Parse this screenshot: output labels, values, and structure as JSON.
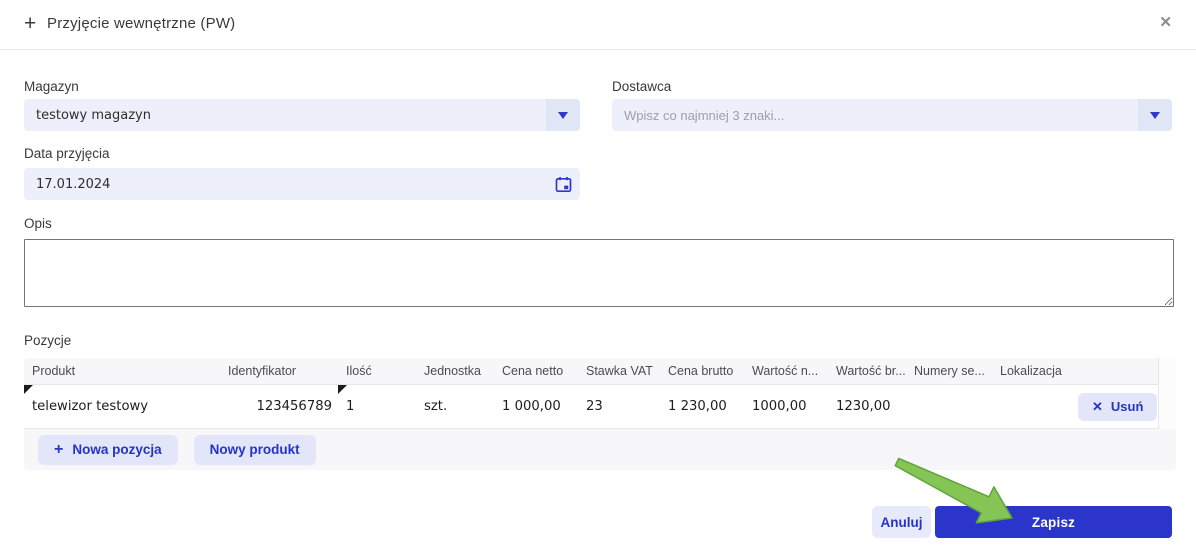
{
  "dialog": {
    "title": "Przyjęcie wewnętrzne (PW)",
    "plus_icon": "+",
    "close_icon": "✕"
  },
  "form": {
    "magazyn": {
      "label": "Magazyn",
      "value": "testowy magazyn"
    },
    "dostawca": {
      "label": "Dostawca",
      "placeholder": "Wpisz co najmniej 3 znaki..."
    },
    "data_przyjecia": {
      "label": "Data przyjęcia",
      "value": "17.01.2024"
    },
    "opis": {
      "label": "Opis",
      "value": ""
    }
  },
  "pozycje": {
    "label": "Pozycje",
    "columns": [
      "Produkt",
      "Identyfikator",
      "Ilość",
      "Jednostka",
      "Cena netto",
      "Stawka VAT",
      "Cena brutto",
      "Wartość n...",
      "Wartość br...",
      "Numery se...",
      "Lokalizacja"
    ],
    "rows": [
      {
        "produkt": "telewizor testowy",
        "identyfikator": "123456789",
        "ilosc": "1",
        "jednostka": "szt.",
        "cena_netto": "1 000,00",
        "stawka_vat": "23",
        "cena_brutto": "1 230,00",
        "wartosc_netto": "1000,00",
        "wartosc_brutto": "1230,00",
        "numery_seryjne": "",
        "lokalizacja": "",
        "usun_label": "Usuń",
        "usun_icon": "✕"
      }
    ],
    "buttons": {
      "nowa_pozycja": "Nowa pozycja",
      "nowa_pozycja_icon": "+",
      "nowy_produkt": "Nowy produkt"
    }
  },
  "footer": {
    "anuluj": "Anuluj",
    "zapisz": "Zapisz"
  },
  "colors": {
    "accent_blue": "#2b34cb",
    "soft_button_bg": "#e3e6f8",
    "field_bg": "#edf0fa",
    "grid_bg": "#f7f7f9",
    "annotation_arrow_green": "#85c555"
  }
}
